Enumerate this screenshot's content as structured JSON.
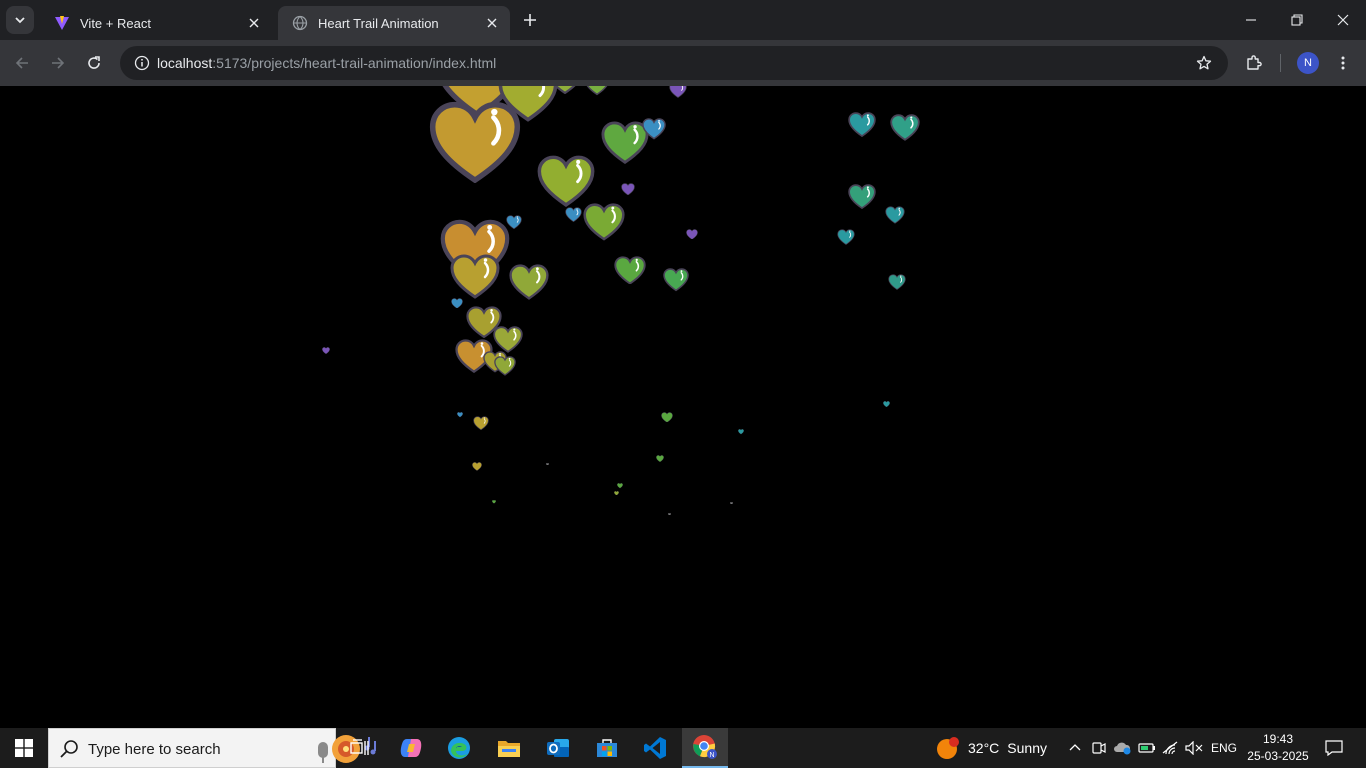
{
  "browser": {
    "tabs": [
      {
        "title": "Vite + React",
        "active": false,
        "favicon": "vite-logo-icon"
      },
      {
        "title": "Heart Trail Animation",
        "active": true,
        "favicon": "globe-icon"
      }
    ],
    "url": {
      "host": "localhost",
      "rest": ":5173/projects/heart-trail-animation/index.html"
    },
    "profile_initial": "N"
  },
  "page": {
    "background": "#000000",
    "content": "heart-trail-animation"
  },
  "taskbar": {
    "search_placeholder": "Type here to search",
    "weather": {
      "temp": "32°C",
      "condition": "Sunny",
      "badge": "1"
    },
    "language": "ENG",
    "time": "19:43",
    "date": "25-03-2025"
  },
  "colors": {
    "chrome_dark": "#202124",
    "chrome_toolbar": "#35363a",
    "taskbar": "#1c1c1c",
    "accent": "#76b9ed"
  }
}
